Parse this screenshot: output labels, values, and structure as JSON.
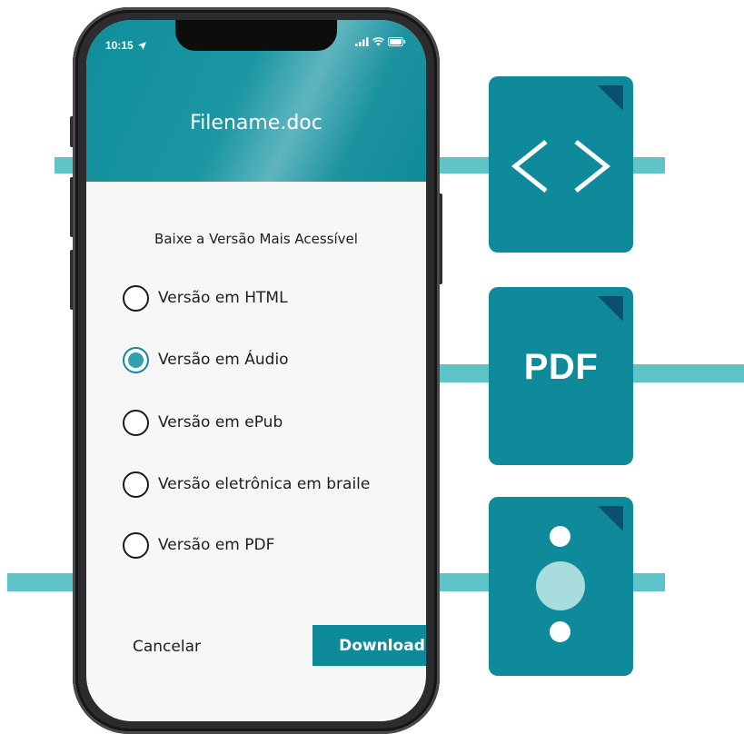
{
  "status_bar": {
    "time": "10:15"
  },
  "header": {
    "title": "Filename.doc"
  },
  "dialog": {
    "subtitle": "Baixe a Versão Mais Acessível",
    "options": [
      {
        "label": "Versão em HTML",
        "selected": false
      },
      {
        "label": "Versão em Áudio",
        "selected": true
      },
      {
        "label": "Versão em ePub",
        "selected": false
      },
      {
        "label": "Versão eletrônica em braile",
        "selected": false
      },
      {
        "label": "Versão em PDF",
        "selected": false
      }
    ],
    "cancel_label": "Cancelar",
    "download_label": "Download"
  },
  "side_icons": {
    "code_icon": "code-brackets-icon",
    "pdf_label": "PDF",
    "audio_icon": "audio-dots-icon"
  },
  "colors": {
    "accent": "#0f8a9a",
    "connector": "#5ec4c8",
    "fold": "#0b4f6c"
  }
}
